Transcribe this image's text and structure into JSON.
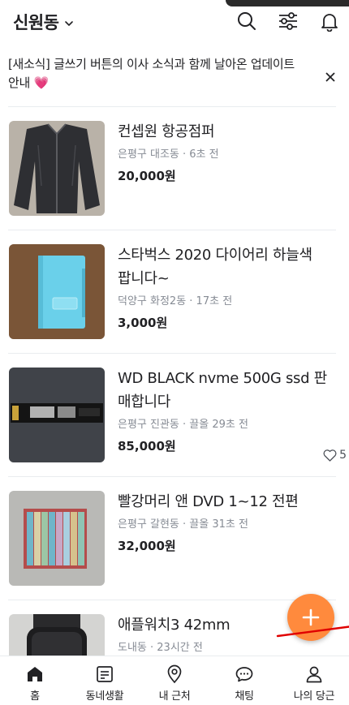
{
  "header": {
    "location": "신원동",
    "icons": [
      "search-icon",
      "filter-icon",
      "bell-icon"
    ]
  },
  "notice": {
    "text": "[새소식] 글쓰기 버튼의 이사 소식과 함께 날아온 업데이트 안내 💗"
  },
  "items": [
    {
      "title": "컨셉원 항공점퍼",
      "meta": "은평구 대조동 · 6초 전",
      "price": "20,000원",
      "likes": ""
    },
    {
      "title": "스타벅스 2020 다이어리 하늘색 팝니다~",
      "meta": "덕양구 화정2동 · 17초 전",
      "price": "3,000원",
      "likes": ""
    },
    {
      "title": "WD BLACK nvme 500G ssd 판매합니다",
      "meta": "은평구 진관동 · 끌올 29초 전",
      "price": "85,000원",
      "likes": "5"
    },
    {
      "title": "빨강머리 앤 DVD 1~12 전편",
      "meta": "은평구 갈현동 · 끌올 31초 전",
      "price": "32,000원",
      "likes": ""
    },
    {
      "title": "애플워치3 42mm",
      "meta": "도내동 · 23시간 전",
      "price": "",
      "likes": ""
    }
  ],
  "nav": [
    {
      "label": "홈",
      "icon": "home-icon"
    },
    {
      "label": "동네생활",
      "icon": "document-icon"
    },
    {
      "label": "내 근처",
      "icon": "location-pin-icon"
    },
    {
      "label": "채팅",
      "icon": "chat-icon"
    },
    {
      "label": "나의 당근",
      "icon": "person-icon"
    }
  ],
  "colors": {
    "accent": "#ff8a3d",
    "meta": "#868b94",
    "annotation": "#e00000"
  }
}
